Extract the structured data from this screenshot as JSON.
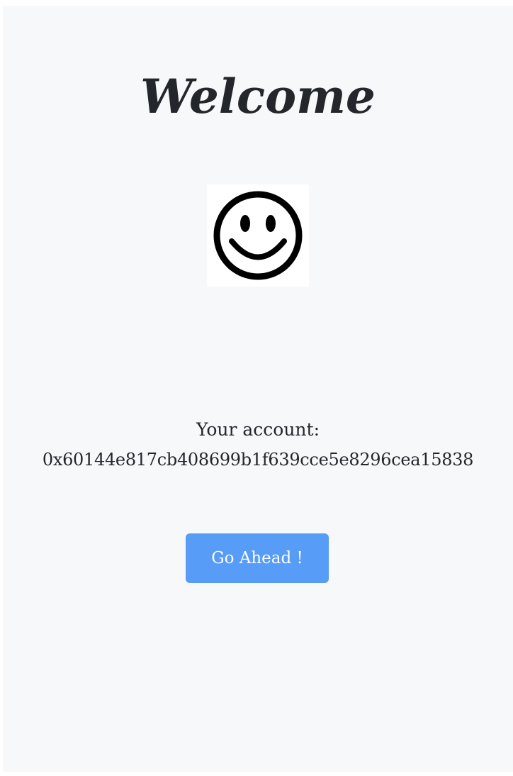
{
  "page": {
    "title": "Welcome",
    "avatar_icon": "smiley-face-icon",
    "account_label": "Your account:",
    "account_address": "0x60144e817cb408699b1f639cce5e8296cea15838",
    "button_label": "Go Ahead !"
  },
  "colors": {
    "background": "#f7f8fa",
    "text": "#23272c",
    "button": "#579cf6",
    "button_text": "#ffffff"
  }
}
